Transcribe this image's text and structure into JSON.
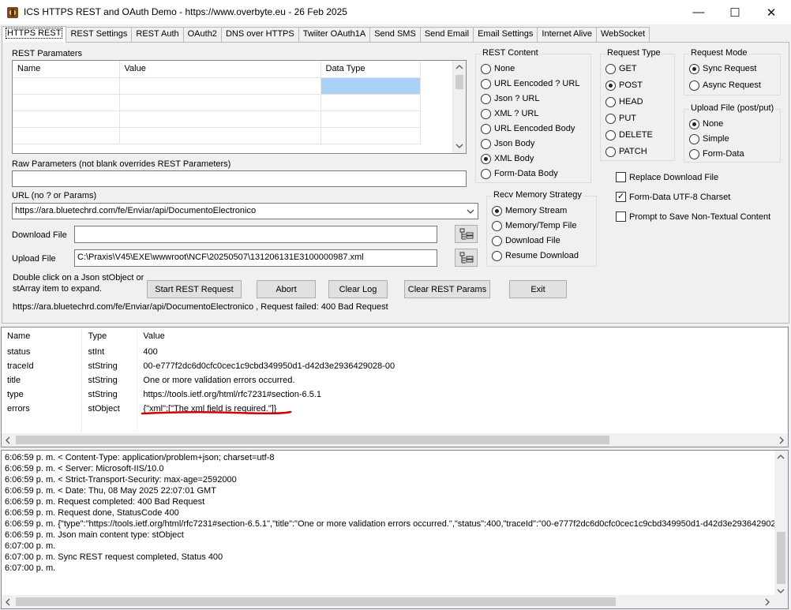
{
  "window": {
    "title": "ICS HTTPS REST and OAuth Demo - https://www.overbyte.eu  - 26 Feb 2025",
    "minimize": "—",
    "maximize": "☐",
    "close": "✕"
  },
  "tabs": [
    "HTTPS REST",
    "REST Settings",
    "REST Auth",
    "OAuth2",
    "DNS over HTTPS",
    "Twiiter OAuth1A",
    "Send SMS",
    "Send Email",
    "Email Settings",
    "Internet Alive",
    "WebSocket"
  ],
  "rest_params": {
    "label": "REST Paramaters",
    "columns": [
      "Name",
      "Value",
      "Data Type"
    ]
  },
  "raw_params": {
    "label": "Raw Parameters (not blank overrides REST Parameters)",
    "value": ""
  },
  "url": {
    "label": "URL (no ? or Params)",
    "value": "https://ara.bluetechrd.com/fe/Enviar/api/DocumentoElectronico"
  },
  "download_file": {
    "label": "Download File",
    "value": ""
  },
  "upload_file": {
    "label": "Upload File",
    "value": "C:\\Praxis\\V45\\EXE\\wwwroot\\NCF\\20250507\\131206131E3100000987.xml"
  },
  "hint": "Double click on a Json stObject or stArray item to expand.",
  "buttons": {
    "start": "Start REST Request",
    "abort": "Abort",
    "clear_log": "Clear Log",
    "clear_params": "Clear REST Params",
    "exit": "Exit"
  },
  "status_line": "https://ara.bluetechrd.com/fe/Enviar/api/DocumentoElectronico , Request failed: 400 Bad Request",
  "rest_content": {
    "label": "REST Content",
    "options": [
      "None",
      "URL Eencoded ? URL",
      "Json ? URL",
      "XML ? URL",
      "URL Eencoded Body",
      "Json Body",
      "XML Body",
      "Form-Data Body"
    ],
    "selected": 6
  },
  "request_type": {
    "label": "Request Type",
    "options": [
      "GET",
      "POST",
      "HEAD",
      "PUT",
      "DELETE",
      "PATCH"
    ],
    "selected": 1
  },
  "request_mode": {
    "label": "Request Mode",
    "options": [
      "Sync Request",
      "Async Request"
    ],
    "selected": 0
  },
  "upload_mode": {
    "label": "Upload File (post/put)",
    "options": [
      "None",
      "Simple",
      "Form-Data"
    ],
    "selected": 0
  },
  "recv_strategy": {
    "label": "Recv Memory Strategy",
    "options": [
      "Memory Stream",
      "Memory/Temp File",
      "Download File",
      "Resume Download"
    ],
    "selected": 0
  },
  "checks": [
    {
      "label": "Replace Download File",
      "checked": false
    },
    {
      "label": "Form-Data UTF-8 Charset",
      "checked": true
    },
    {
      "label": "Prompt to Save Non-Textual Content",
      "checked": false
    }
  ],
  "json_list": {
    "columns": [
      "Name",
      "Type",
      "Value"
    ],
    "rows": [
      {
        "name": "status",
        "type": "stInt",
        "value": "400"
      },
      {
        "name": "traceId",
        "type": "stString",
        "value": "00-e777f2dc6d0cfc0cec1c9cbd349950d1-d42d3e2936429028-00"
      },
      {
        "name": "title",
        "type": "stString",
        "value": "One or more validation errors occurred."
      },
      {
        "name": "type",
        "type": "stString",
        "value": "https://tools.ietf.org/html/rfc7231#section-6.5.1"
      },
      {
        "name": "errors",
        "type": "stObject",
        "value": "{\"xml\":[\"The xml field is required.\"]}"
      }
    ]
  },
  "log_lines": [
    "6:06:59 p. m. < Content-Type: application/problem+json; charset=utf-8",
    "6:06:59 p. m. < Server: Microsoft-IIS/10.0",
    "6:06:59 p. m. < Strict-Transport-Security: max-age=2592000",
    "6:06:59 p. m. < Date: Thu, 08 May 2025 22:07:01 GMT",
    "6:06:59 p. m. Request completed: 400 Bad Request",
    "6:06:59 p. m. Request done, StatusCode 400",
    "6:06:59 p. m. {\"type\":\"https://tools.ietf.org/html/rfc7231#section-6.5.1\",\"title\":\"One or more validation errors occurred.\",\"status\":400,\"traceId\":\"00-e777f2dc6d0cfc0cec1c9cbd349950d1-d42d3e293642902",
    "6:06:59 p. m. Json main content type: stObject",
    "6:07:00 p. m.",
    "6:07:00 p. m. Sync REST request completed, Status 400",
    "6:07:00 p. m."
  ],
  "colors": {
    "selected_cell": "#a9d0f5",
    "annotation": "#d00000"
  }
}
